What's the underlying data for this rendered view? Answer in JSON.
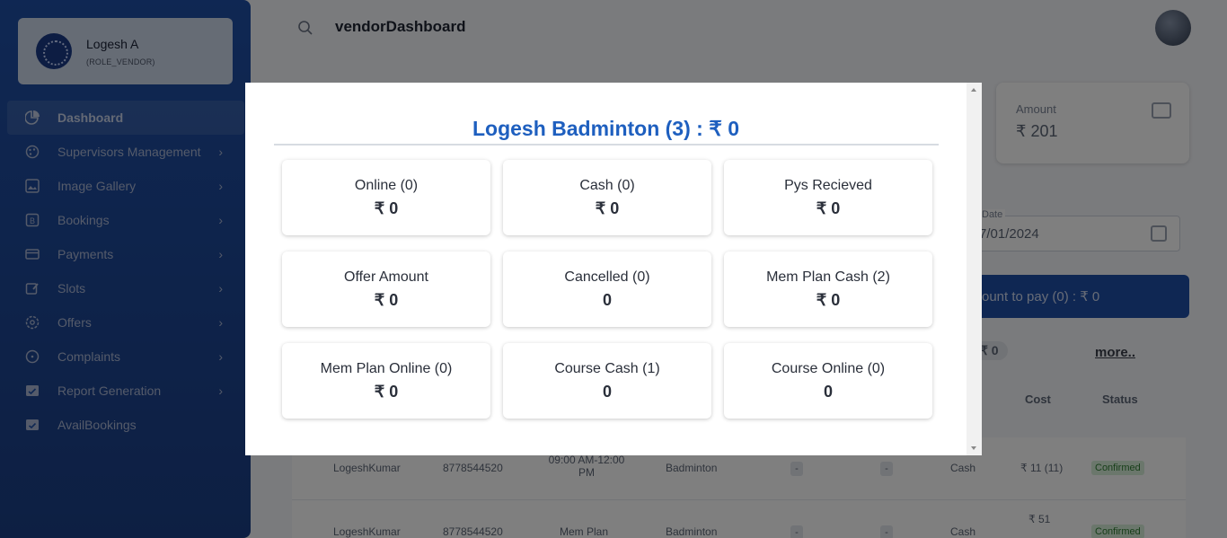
{
  "header": {
    "page_title": "vendorDashboard"
  },
  "profile": {
    "name": "Logesh A",
    "role": "(ROLE_VENDOR)"
  },
  "sidebar": {
    "items": [
      {
        "label": "Dashboard",
        "icon": "pie-chart-icon"
      },
      {
        "label": "Supervisors Management",
        "icon": "palette-icon"
      },
      {
        "label": "Image Gallery",
        "icon": "gallery-icon"
      },
      {
        "label": "Bookings",
        "icon": "bookings-icon"
      },
      {
        "label": "Payments",
        "icon": "credit-card-icon"
      },
      {
        "label": "Slots",
        "icon": "edit-calendar-icon"
      },
      {
        "label": "Offers",
        "icon": "offers-icon"
      },
      {
        "label": "Complaints",
        "icon": "complaint-icon"
      },
      {
        "label": "Report Generation",
        "icon": "report-icon"
      },
      {
        "label": "AvailBookings",
        "icon": "calendar-check-icon"
      }
    ]
  },
  "background": {
    "amount_label": "Amount",
    "amount_value": "₹ 201",
    "date_label": "Date",
    "date_value": "7/01/2024",
    "pay_banner": "ount to pay (0) : ₹ 0",
    "chip_zero": "₹ 0",
    "more_link": "more..",
    "columns": {
      "cost": "Cost",
      "status": "Status"
    },
    "rows": [
      {
        "name": "LogeshKumar",
        "phone": "8778544520",
        "slot": "09:00 AM-12:00 PM",
        "sport": "Badminton",
        "c1": "-",
        "c2": "-",
        "mode": "Cash",
        "cost": "₹ 11 (11)",
        "status": "Confirmed"
      },
      {
        "name": "LogeshKumar",
        "phone": "8778544520",
        "slot": "Mem Plan",
        "sport": "Badminton",
        "c1": "-",
        "c2": "-",
        "mode": "Cash",
        "cost": "₹ 51",
        "status": "Confirmed"
      }
    ]
  },
  "modal": {
    "title": "Logesh Badminton (3) : ₹ 0",
    "stats": [
      {
        "label": "Online (0)",
        "value": "₹ 0"
      },
      {
        "label": "Cash (0)",
        "value": "₹ 0"
      },
      {
        "label": "Pys Recieved",
        "value": "₹ 0"
      },
      {
        "label": "Offer Amount",
        "value": "₹ 0"
      },
      {
        "label": "Cancelled (0)",
        "value": "0"
      },
      {
        "label": "Mem Plan Cash (2)",
        "value": "₹ 0"
      },
      {
        "label": "Mem Plan Online (0)",
        "value": "₹ 0"
      },
      {
        "label": "Course Cash (1)",
        "value": "0"
      },
      {
        "label": "Course Online (0)",
        "value": "0"
      }
    ]
  }
}
